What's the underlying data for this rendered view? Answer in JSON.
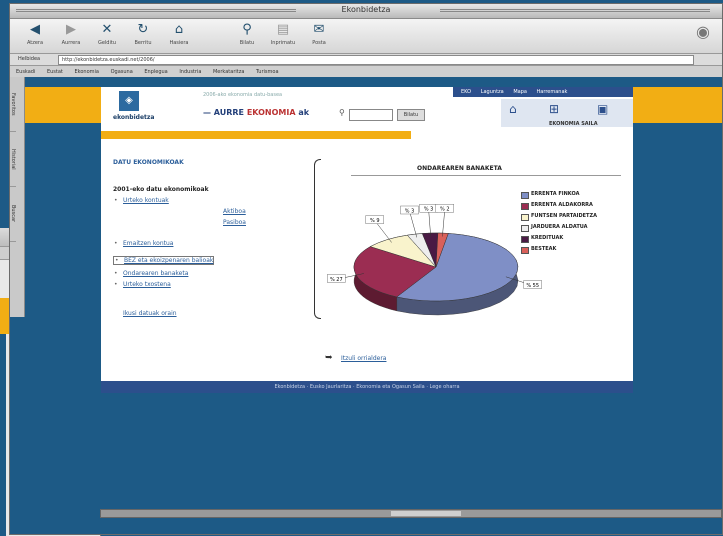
{
  "window": {
    "title": "Ekonbidetza"
  },
  "toolbar": [
    {
      "label": "Atzera",
      "icon": "back-icon"
    },
    {
      "label": "Aurrera",
      "icon": "forward-icon"
    },
    {
      "label": "Gelditu",
      "icon": "stop-icon"
    },
    {
      "label": "Berritu",
      "icon": "refresh-icon"
    },
    {
      "label": "Hasiera",
      "icon": "home-icon"
    },
    {
      "label": "Bilatu",
      "icon": "search-icon"
    },
    {
      "label": "Inprimatu",
      "icon": "print-icon"
    },
    {
      "label": "Posta",
      "icon": "mail-icon"
    }
  ],
  "address": {
    "label": "Helbidea",
    "value": "http://ekonbidetza.euskadi.net/2006/"
  },
  "links": [
    "Euskadi",
    "Eustat",
    "Ekonomia",
    "Ogasuna",
    "Enplegua",
    "Industria",
    "Merkataritza",
    "Turismoa"
  ],
  "sidebar_tabs": [
    "Favoritos",
    "Historial",
    "Buscar"
  ],
  "site": {
    "logo_text": "ekonbidetza",
    "tagline": "2006-ako ekonomia datu-basea",
    "aurrebi_prefix": "— AURRE",
    "aurrebi_highlight": "EKONOMIA",
    "aurrebi_suffix": "ak",
    "search_button": "Bilatu",
    "nav": [
      "EKO",
      "Laguntza",
      "Mapa",
      "Harremanak"
    ],
    "nav_caption": "EKONOMIA SAILA"
  },
  "menu": {
    "title": "DATU EKONOMIKOAK",
    "subtitle": "2001-eko datu ekonomikoak",
    "items": [
      {
        "label": "Urteko kontuak",
        "class": ""
      },
      {
        "label": "Aktiboa",
        "class": "ind nb"
      },
      {
        "label": "Pasiboa",
        "class": "ind nb"
      },
      {
        "label": "Emaitzen kontua",
        "class": ""
      },
      {
        "label": "BEZ eta ekoizpenaren balioak",
        "class": "box"
      },
      {
        "label": "Ondarearen banaketa",
        "class": ""
      },
      {
        "label": "Urteko txostena",
        "class": ""
      },
      {
        "label": "Ikusi datuak orain",
        "class": "nb"
      }
    ]
  },
  "chart_data": {
    "type": "pie",
    "title": "ONDAREAREN BANAKETA",
    "slices": [
      {
        "name": "ERRENTA FINKOA",
        "value": 55,
        "label": "% 55",
        "color": "#7f8fc6"
      },
      {
        "name": "ERRENTA ALDAKORRA",
        "value": 27,
        "label": "% 27",
        "color": "#9b2d52"
      },
      {
        "name": "FUNTSEN PARTAIDETZA",
        "value": 9,
        "label": "% 9",
        "color": "#f9f3cc"
      },
      {
        "name": "JARDUERA ALDATUA",
        "value": 3,
        "label": "% 3",
        "color": "#eeeeee"
      },
      {
        "name": "KREDITUAK",
        "value": 3,
        "label": "% 3",
        "color": "#4a1a44"
      },
      {
        "name": "BESTEAK",
        "value": 2,
        "label": "% 2",
        "color": "#d9605a"
      }
    ]
  },
  "footer_link": "Itzuli orrialdera",
  "bottom_bar": "Ekonbidetza · Eusko Jaurlaritza · Ekonomia eta Ogasun Saila · Lege oharra"
}
